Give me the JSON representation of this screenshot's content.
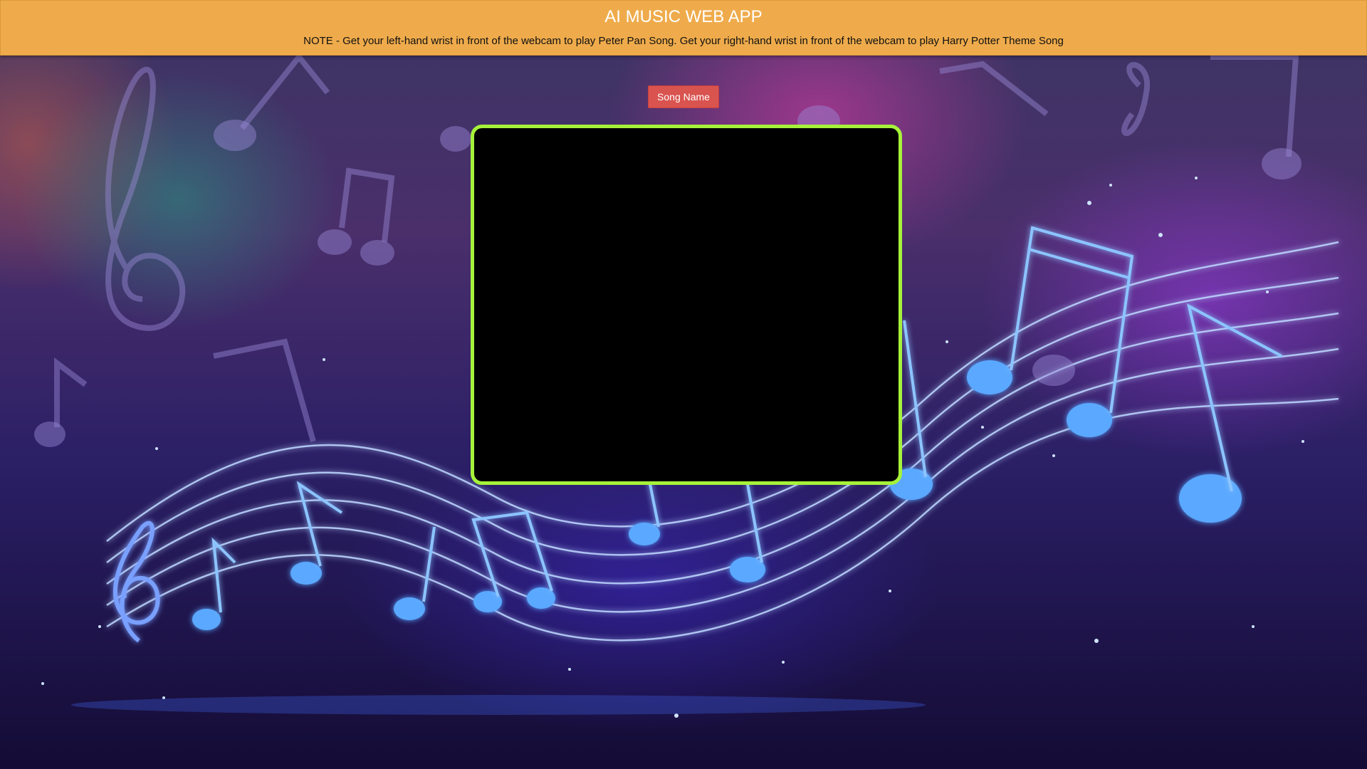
{
  "header": {
    "title": "AI MUSIC WEB APP",
    "note": "NOTE - Get your left-hand wrist in front of the webcam to play Peter Pan Song. Get your right-hand wrist in front of the webcam to play Harry Potter Theme Song"
  },
  "controls": {
    "song_name_label": "Song Name"
  },
  "colors": {
    "header_bg": "#efab4b",
    "button_bg": "#d9534f",
    "webcam_border": "#a6f23a"
  },
  "icons": [
    "music-notes-background"
  ]
}
